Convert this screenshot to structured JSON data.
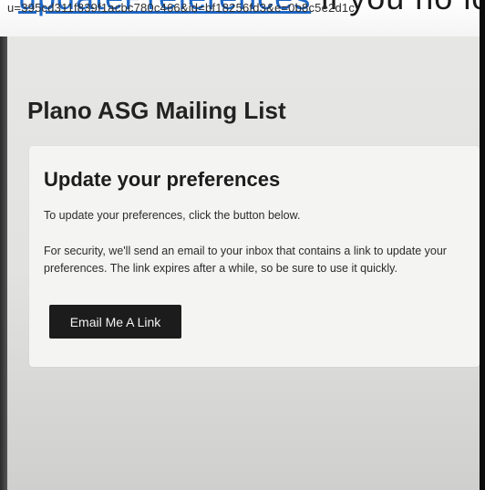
{
  "browser": {
    "partial_heading_link": "updatePreferences",
    "partial_heading_rest": " if you no longer want to receive",
    "url_fragment": "u=395cd311f839f1acbc780c466&id=bf18256fd3&e=0b8c5e2d1c"
  },
  "page": {
    "title": "Plano ASG Mailing List"
  },
  "card": {
    "title": "Update your preferences",
    "para1": "To update your preferences, click the button below.",
    "para2": "For security, we'll send an email to your inbox that contains a link to update your preferences. The link expires after a while, so be sure to use it quickly.",
    "button_label": "Email Me A Link"
  }
}
